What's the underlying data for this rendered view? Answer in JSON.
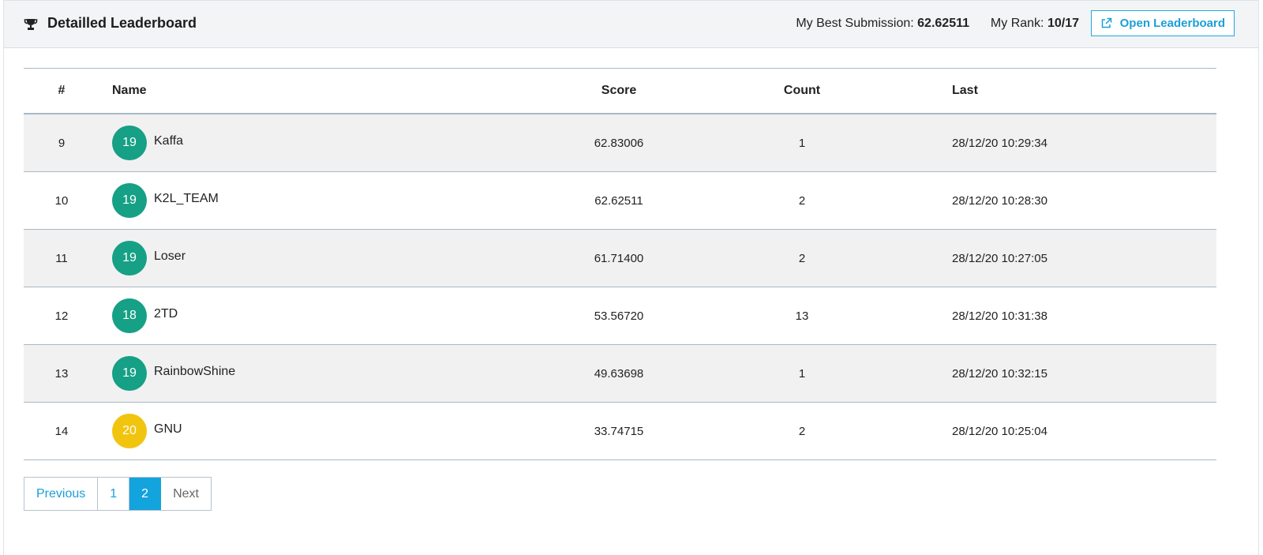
{
  "header": {
    "title": "Detailled Leaderboard",
    "best_label": "My Best Submission:",
    "best_value": "62.62511",
    "rank_label": "My Rank:",
    "rank_value": "10/17",
    "open_label": "Open Leaderboard",
    "icons": {
      "title": "trophy-icon",
      "open": "external-link-icon"
    }
  },
  "table": {
    "headers": {
      "rank": "#",
      "name": "Name",
      "score": "Score",
      "count": "Count",
      "last": "Last"
    },
    "rows": [
      {
        "rank": "9",
        "badge": "19",
        "name": "Kaffa",
        "score": "62.83006",
        "count": "1",
        "last": "28/12/20 10:29:34"
      },
      {
        "rank": "10",
        "badge": "19",
        "name": "K2L_TEAM",
        "score": "62.62511",
        "count": "2",
        "last": "28/12/20 10:28:30"
      },
      {
        "rank": "11",
        "badge": "19",
        "name": "Loser",
        "score": "61.71400",
        "count": "2",
        "last": "28/12/20 10:27:05"
      },
      {
        "rank": "12",
        "badge": "18",
        "name": "2TD",
        "score": "53.56720",
        "count": "13",
        "last": "28/12/20 10:31:38"
      },
      {
        "rank": "13",
        "badge": "19",
        "name": "RainbowShine",
        "score": "49.63698",
        "count": "1",
        "last": "28/12/20 10:32:15"
      },
      {
        "rank": "14",
        "badge": "20",
        "name": "GNU",
        "score": "33.74715",
        "count": "2",
        "last": "28/12/20 10:25:04"
      }
    ]
  },
  "badge_colors": {
    "18": "#16a085",
    "19": "#16a085",
    "20": "#f1c40f"
  },
  "pagination": {
    "previous": "Previous",
    "pages": [
      "1",
      "2"
    ],
    "active_page": "2",
    "next": "Next"
  }
}
